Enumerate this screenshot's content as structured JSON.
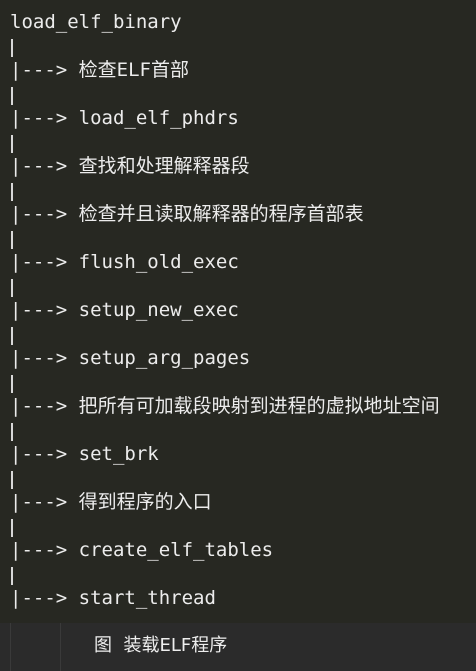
{
  "root": "load_elf_binary",
  "branch_prefix": "|---> ",
  "steps": [
    "检查ELF首部",
    "load_elf_phdrs",
    "查找和处理解释器段",
    "检查并且读取解释器的程序首部表",
    "flush_old_exec",
    "setup_new_exec",
    "setup_arg_pages",
    "把所有可加载段映射到进程的虚拟地址空间",
    "set_brk",
    "得到程序的入口",
    "create_elf_tables",
    "start_thread"
  ],
  "caption": "图  装载ELF程序",
  "colors": {
    "background": "#272822",
    "text": "#ececec",
    "caption_background": "#2b2b2b"
  }
}
